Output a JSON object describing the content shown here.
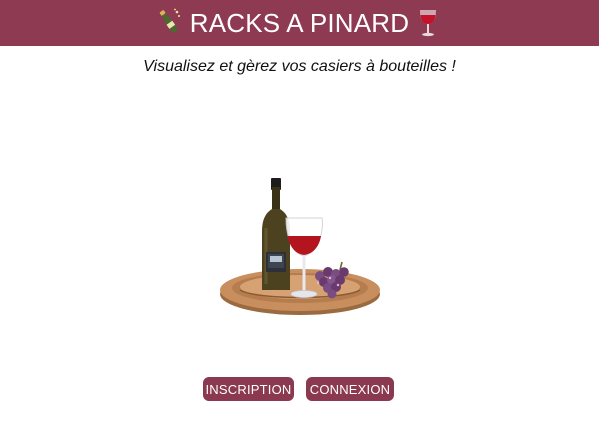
{
  "colors": {
    "brand": "#8e3a52",
    "button": "#8b3950",
    "wine": "#b3141e",
    "tray": "#c88e5e",
    "grapes": "#6a3a6e"
  },
  "header": {
    "title": "RACKS A PINARD",
    "left_icon": "champagne-bottle-icon",
    "right_icon": "wine-glass-icon"
  },
  "tagline": "Visualisez et gèrez vos casiers à bouteilles !",
  "hero": {
    "icon": "wine-bottle-glass-grapes-tray-illustration"
  },
  "actions": {
    "inscription": "INSCRIPTION",
    "connexion": "CONNEXION"
  }
}
